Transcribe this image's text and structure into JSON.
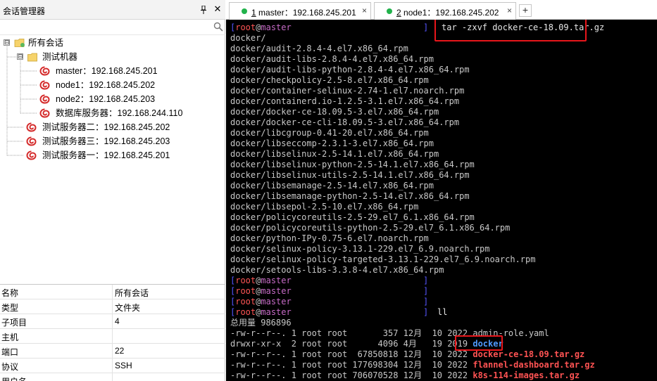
{
  "left_panel": {
    "title": "会话管理器",
    "pin_icon": "pin-icon",
    "close_icon": "close-icon",
    "search_icon": "search-icon",
    "tree": {
      "root": {
        "label": "所有会话",
        "toggle": "⊟"
      },
      "group": {
        "label": "测试机器",
        "toggle": "⊟"
      },
      "group_items": [
        {
          "label": "master：192.168.245.201"
        },
        {
          "label": "node1：192.168.245.202"
        },
        {
          "label": "node2：192.168.245.203"
        },
        {
          "label": "数据库服务器：192.168.244.110"
        }
      ],
      "root_items": [
        {
          "label": "测试服务器二：192.168.245.202"
        },
        {
          "label": "测试服务器三：192.168.245.203"
        },
        {
          "label": "测试服务器一：192.168.245.201"
        }
      ]
    },
    "properties": [
      {
        "key": "名称",
        "value": "所有会话"
      },
      {
        "key": "类型",
        "value": "文件夹"
      },
      {
        "key": "子项目",
        "value": "4"
      },
      {
        "key": "主机",
        "value": ""
      },
      {
        "key": "端口",
        "value": "22"
      },
      {
        "key": "协议",
        "value": "SSH"
      },
      {
        "key": "用户名",
        "value": ""
      }
    ]
  },
  "tabs": [
    {
      "num": "1",
      "label": " master：192.168.245.201",
      "close": "×",
      "active": true
    },
    {
      "num": "2",
      "label": " node1：192.168.245.202",
      "close": "×",
      "active": false
    }
  ],
  "tab_add_label": "+",
  "terminal": {
    "prompt": {
      "open": "[",
      "user": "root",
      "at": "@",
      "host": "master",
      "close": "]"
    },
    "command_tar": "tar -zxvf docker-ce-18.09.tar.gz",
    "tar_output": [
      "docker/",
      "docker/audit-2.8.4-4.el7.x86_64.rpm",
      "docker/audit-libs-2.8.4-4.el7.x86_64.rpm",
      "docker/audit-libs-python-2.8.4-4.el7.x86_64.rpm",
      "docker/checkpolicy-2.5-8.el7.x86_64.rpm",
      "docker/container-selinux-2.74-1.el7.noarch.rpm",
      "docker/containerd.io-1.2.5-3.1.el7.x86_64.rpm",
      "docker/docker-ce-18.09.5-3.el7.x86_64.rpm",
      "docker/docker-ce-cli-18.09.5-3.el7.x86_64.rpm",
      "docker/libcgroup-0.41-20.el7.x86_64.rpm",
      "docker/libseccomp-2.3.1-3.el7.x86_64.rpm",
      "docker/libselinux-2.5-14.1.el7.x86_64.rpm",
      "docker/libselinux-python-2.5-14.1.el7.x86_64.rpm",
      "docker/libselinux-utils-2.5-14.1.el7.x86_64.rpm",
      "docker/libsemanage-2.5-14.el7.x86_64.rpm",
      "docker/libsemanage-python-2.5-14.el7.x86_64.rpm",
      "docker/libsepol-2.5-10.el7.x86_64.rpm",
      "docker/policycoreutils-2.5-29.el7_6.1.x86_64.rpm",
      "docker/policycoreutils-python-2.5-29.el7_6.1.x86_64.rpm",
      "docker/python-IPy-0.75-6.el7.noarch.rpm",
      "docker/selinux-policy-3.13.1-229.el7_6.9.noarch.rpm",
      "docker/selinux-policy-targeted-3.13.1-229.el7_6.9.noarch.rpm",
      "docker/setools-libs-3.3.8-4.el7.x86_64.rpm"
    ],
    "command_ll": "ll",
    "total_line": "总用量 986896",
    "listing": [
      {
        "meta": "-rw-r--r--. 1 root root       357 12月  10 2022 ",
        "name": "admin-role.yaml",
        "kind": "file"
      },
      {
        "meta": "drwxr-xr-x  2 root root      4096 4月   19 2019 ",
        "name": "docker",
        "kind": "dir"
      },
      {
        "meta": "-rw-r--r--. 1 root root  67850818 12月  10 2022 ",
        "name": "docker-ce-18.09.tar.gz",
        "kind": "archive"
      },
      {
        "meta": "-rw-r--r--. 1 root root 177698304 12月  10 2022 ",
        "name": "flannel-dashboard.tar.gz",
        "kind": "archive"
      },
      {
        "meta": "-rw-r--r--. 1 root root 706070528 12月  10 2022 ",
        "name": "k8s-114-images.tar.gz",
        "kind": "archive"
      }
    ]
  },
  "colors": {
    "terminal_bg": "#000000",
    "highlight_box": "#e8161b",
    "tab_status_dot": "#21b24b",
    "dir_color": "#4f9bff",
    "archive_color": "#ff5353"
  }
}
